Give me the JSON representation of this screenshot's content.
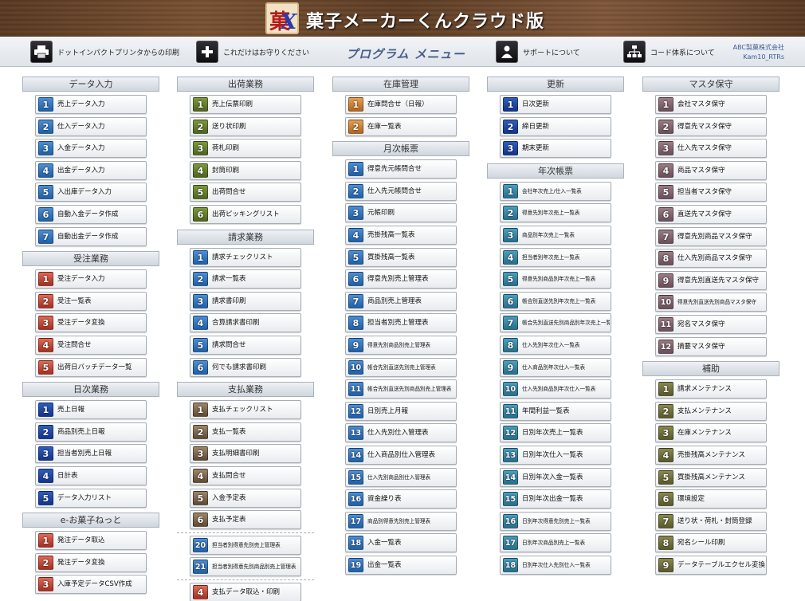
{
  "header": {
    "title": "菓子メーカーくんクラウド版",
    "logo_text": "菓X"
  },
  "toolbar": {
    "print_label": "ドットインパクトプリンタからの印刷",
    "notice_label": "これだけはお守りください",
    "menu_title": "プログラム メニュー",
    "support_label": "サポートについて",
    "code_label": "コード体系について",
    "company": "ABC製菓株式会社",
    "user": "Kam10_RTRs"
  },
  "columns": [
    {
      "sections": [
        {
          "title": "データ入力",
          "color": "blue",
          "items": [
            {
              "num": "1",
              "label": "売上データ入力"
            },
            {
              "num": "2",
              "label": "仕入データ入力"
            },
            {
              "num": "3",
              "label": "入金データ入力"
            },
            {
              "num": "4",
              "label": "出金データ入力"
            },
            {
              "num": "5",
              "label": "入出庫データ入力"
            },
            {
              "num": "6",
              "label": "自動入金データ作成"
            },
            {
              "num": "7",
              "label": "自動出金データ作成"
            }
          ]
        },
        {
          "title": "受注業務",
          "color": "red",
          "items": [
            {
              "num": "1",
              "label": "受注データ入力"
            },
            {
              "num": "2",
              "label": "受注一覧表"
            },
            {
              "num": "3",
              "label": "受注データ変換"
            },
            {
              "num": "4",
              "label": "受注問合せ"
            },
            {
              "num": "5",
              "label": "出荷日バッチデータ一覧"
            }
          ]
        },
        {
          "title": "日次業務",
          "color": "dark",
          "items": [
            {
              "num": "1",
              "label": "売上日報"
            },
            {
              "num": "2",
              "label": "商品別売上日報"
            },
            {
              "num": "3",
              "label": "担当者別売上日報"
            },
            {
              "num": "4",
              "label": "日計表"
            },
            {
              "num": "5",
              "label": "データ入力リスト"
            }
          ]
        },
        {
          "title": "e-お菓子ねっと",
          "color": "red",
          "items": [
            {
              "num": "1",
              "label": "発注データ取込"
            },
            {
              "num": "2",
              "label": "発注データ変換"
            },
            {
              "num": "3",
              "label": "入庫予定データCSV作成"
            }
          ]
        }
      ]
    },
    {
      "sections": [
        {
          "title": "出荷業務",
          "color": "green",
          "items": [
            {
              "num": "1",
              "label": "売上伝票印刷"
            },
            {
              "num": "2",
              "label": "送り状印刷"
            },
            {
              "num": "3",
              "label": "荷札印刷"
            },
            {
              "num": "4",
              "label": "封筒印刷"
            },
            {
              "num": "5",
              "label": "出荷問合せ"
            },
            {
              "num": "6",
              "label": "出荷ピッキングリスト"
            }
          ]
        },
        {
          "title": "請求業務",
          "color": "blue",
          "items": [
            {
              "num": "1",
              "label": "請求チェックリスト"
            },
            {
              "num": "2",
              "label": "請求一覧表"
            },
            {
              "num": "3",
              "label": "請求書印刷"
            },
            {
              "num": "4",
              "label": "合算請求書印刷"
            },
            {
              "num": "5",
              "label": "請求問合せ"
            },
            {
              "num": "6",
              "label": "何でも請求書印刷"
            }
          ]
        },
        {
          "title": "支払業務",
          "color": "brown",
          "items": [
            {
              "num": "1",
              "label": "支払チェックリスト"
            },
            {
              "num": "2",
              "label": "支払一覧表"
            },
            {
              "num": "3",
              "label": "支払明細書印刷"
            },
            {
              "num": "4",
              "label": "支払問合せ"
            },
            {
              "num": "5",
              "label": "入金予定表"
            },
            {
              "num": "6",
              "label": "支払予定表"
            }
          ]
        },
        {
          "extra": true,
          "color": "blue",
          "items": [
            {
              "num": "20",
              "label": "担当者別得意先別売上管理表",
              "small": true
            },
            {
              "num": "21",
              "label": "担当者別得意先別商品別売上管理表",
              "small": true
            }
          ]
        },
        {
          "extra": true,
          "color": "red",
          "items": [
            {
              "num": "4",
              "label": "支払データ取込・印刷"
            }
          ]
        }
      ]
    },
    {
      "sections": [
        {
          "title": "在庫管理",
          "color": "orange",
          "items": [
            {
              "num": "1",
              "label": "在庫問合せ（日報）"
            },
            {
              "num": "2",
              "label": "在庫一覧表"
            }
          ]
        },
        {
          "title": "月次帳票",
          "color": "blue",
          "items": [
            {
              "num": "1",
              "label": "得意先元帳問合せ"
            },
            {
              "num": "2",
              "label": "仕入先元帳問合せ"
            },
            {
              "num": "3",
              "label": "元帳印刷"
            },
            {
              "num": "4",
              "label": "売掛残高一覧表"
            },
            {
              "num": "5",
              "label": "買掛残高一覧表"
            },
            {
              "num": "6",
              "label": "得意先別売上管理表"
            },
            {
              "num": "7",
              "label": "商品別売上管理表"
            },
            {
              "num": "8",
              "label": "担当者別売上管理表"
            },
            {
              "num": "9",
              "label": "得意先別商品別売上管理表",
              "small": true
            },
            {
              "num": "10",
              "label": "帳合先別直送先別売上管理表",
              "small": true
            },
            {
              "num": "11",
              "label": "帳合先別直送先別商品別売上管理表",
              "small": true
            },
            {
              "num": "12",
              "label": "日別売上月報"
            },
            {
              "num": "13",
              "label": "仕入先別仕入管理表"
            },
            {
              "num": "14",
              "label": "仕入商品別仕入管理表"
            },
            {
              "num": "15",
              "label": "仕入先別商品別仕入管理表",
              "small": true
            },
            {
              "num": "16",
              "label": "資金繰り表"
            },
            {
              "num": "17",
              "label": "商品別得意先別売上管理表",
              "small": true
            },
            {
              "num": "18",
              "label": "入金一覧表"
            },
            {
              "num": "19",
              "label": "出金一覧表"
            }
          ]
        }
      ]
    },
    {
      "sections": [
        {
          "title": "更新",
          "color": "dark",
          "items": [
            {
              "num": "1",
              "label": "日次更新"
            },
            {
              "num": "2",
              "label": "締日更新"
            },
            {
              "num": "3",
              "label": "期末更新"
            }
          ]
        },
        {
          "title": "年次帳票",
          "color": "teal",
          "items": [
            {
              "num": "1",
              "label": "会社年次売上/仕入一覧表",
              "small": true
            },
            {
              "num": "2",
              "label": "得意先別年次売上一覧表",
              "small": true
            },
            {
              "num": "3",
              "label": "商品別年次売上一覧表",
              "small": true
            },
            {
              "num": "4",
              "label": "担当者別年次売上一覧表",
              "small": true
            },
            {
              "num": "5",
              "label": "得意先別商品別年次売上一覧表",
              "small": true
            },
            {
              "num": "6",
              "label": "帳合別直送先別年次売上一覧表",
              "small": true
            },
            {
              "num": "7",
              "label": "帳合先別直送先別商品別年次売上一覧表",
              "small": true
            },
            {
              "num": "8",
              "label": "仕入先別年次仕入一覧表",
              "small": true
            },
            {
              "num": "9",
              "label": "仕入商品別年次仕入一覧表",
              "small": true
            },
            {
              "num": "10",
              "label": "仕入先別商品別年次仕入一覧表",
              "small": true
            },
            {
              "num": "11",
              "label": "年間利益一覧表"
            },
            {
              "num": "12",
              "label": "日別年次売上一覧表"
            },
            {
              "num": "13",
              "label": "日別年次仕入一覧表"
            },
            {
              "num": "14",
              "label": "日別年次入金一覧表"
            },
            {
              "num": "15",
              "label": "日別年次出金一覧表"
            },
            {
              "num": "16",
              "label": "日別年次得意先別売上一覧表",
              "small": true
            },
            {
              "num": "17",
              "label": "日別年次商品別売上一覧表",
              "small": true
            },
            {
              "num": "18",
              "label": "日別年次仕入先別仕入一覧表",
              "small": true
            }
          ]
        }
      ]
    },
    {
      "sections": [
        {
          "title": "マスタ保守",
          "color": "mauve",
          "items": [
            {
              "num": "1",
              "label": "会社マスタ保守"
            },
            {
              "num": "2",
              "label": "得意先マスタ保守"
            },
            {
              "num": "3",
              "label": "仕入先マスタ保守"
            },
            {
              "num": "4",
              "label": "商品マスタ保守"
            },
            {
              "num": "5",
              "label": "担当者マスタ保守"
            },
            {
              "num": "6",
              "label": "直送先マスタ保守"
            },
            {
              "num": "7",
              "label": "得意先別商品マスタ保守"
            },
            {
              "num": "8",
              "label": "仕入先別商品マスタ保守"
            },
            {
              "num": "9",
              "label": "得意先別直送先マスタ保守"
            },
            {
              "num": "10",
              "label": "得意先別直送先別商品マスタ保守",
              "small": true
            },
            {
              "num": "11",
              "label": "宛名マスタ保守"
            },
            {
              "num": "12",
              "label": "摘要マスタ保守"
            }
          ]
        },
        {
          "title": "補助",
          "color": "olive",
          "items": [
            {
              "num": "1",
              "label": "請求メンテナンス"
            },
            {
              "num": "2",
              "label": "支払メンテナンス"
            },
            {
              "num": "3",
              "label": "在庫メンテナンス"
            },
            {
              "num": "4",
              "label": "売掛残高メンテナンス"
            },
            {
              "num": "5",
              "label": "買掛残高メンテナンス"
            },
            {
              "num": "6",
              "label": "環境設定"
            },
            {
              "num": "7",
              "label": "送り状・荷札・封筒登録"
            },
            {
              "num": "8",
              "label": "宛名シール印刷"
            },
            {
              "num": "9",
              "label": "データテーブルエクセル変換"
            }
          ]
        }
      ]
    }
  ]
}
